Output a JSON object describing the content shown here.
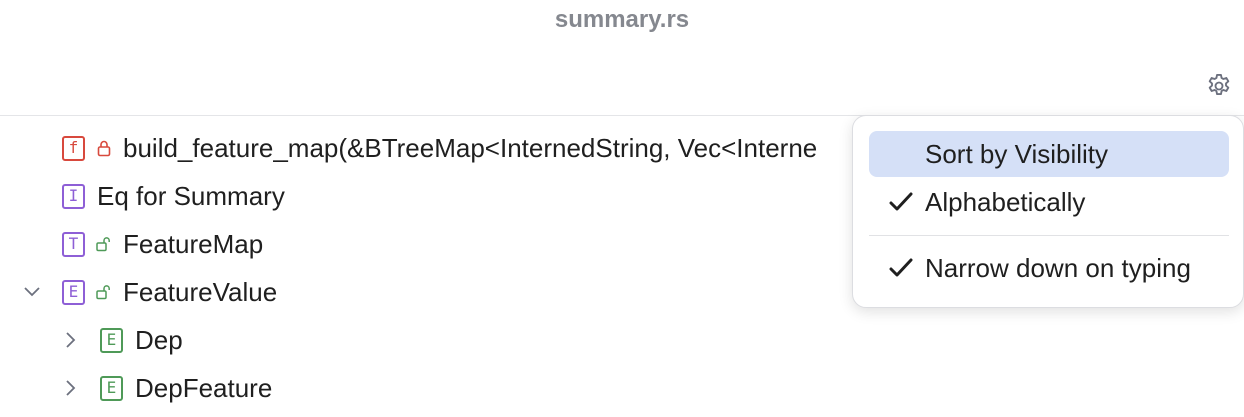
{
  "window": {
    "title": "summary.rs"
  },
  "toolbar": {
    "settings_icon": "gear-icon"
  },
  "tree": {
    "items": [
      {
        "badge": "f",
        "badge_color": "#d8493d",
        "visibility": "private-lock-icon",
        "label": "build_feature_map(&BTreeMap<InternedString, Vec<Interne"
      },
      {
        "badge": "I",
        "badge_color": "#8e5fd6",
        "label": "Eq for Summary"
      },
      {
        "badge": "T",
        "badge_color": "#8e5fd6",
        "visibility": "public-lock-icon",
        "label": "FeatureMap"
      },
      {
        "badge": "E",
        "badge_color": "#8e5fd6",
        "visibility": "public-lock-icon",
        "expanded": true,
        "label": "FeatureValue"
      },
      {
        "badge": "E",
        "badge_color": "#4f9a58",
        "expanded": false,
        "label": "Dep"
      },
      {
        "badge": "E",
        "badge_color": "#4f9a58",
        "expanded": false,
        "label": "DepFeature"
      }
    ]
  },
  "menu": {
    "items": [
      {
        "label": "Sort by Visibility",
        "checked": false,
        "highlighted": true
      },
      {
        "label": "Alphabetically",
        "checked": true,
        "highlighted": false
      },
      {
        "label": "Narrow down on typing",
        "checked": true,
        "highlighted": false
      }
    ]
  }
}
